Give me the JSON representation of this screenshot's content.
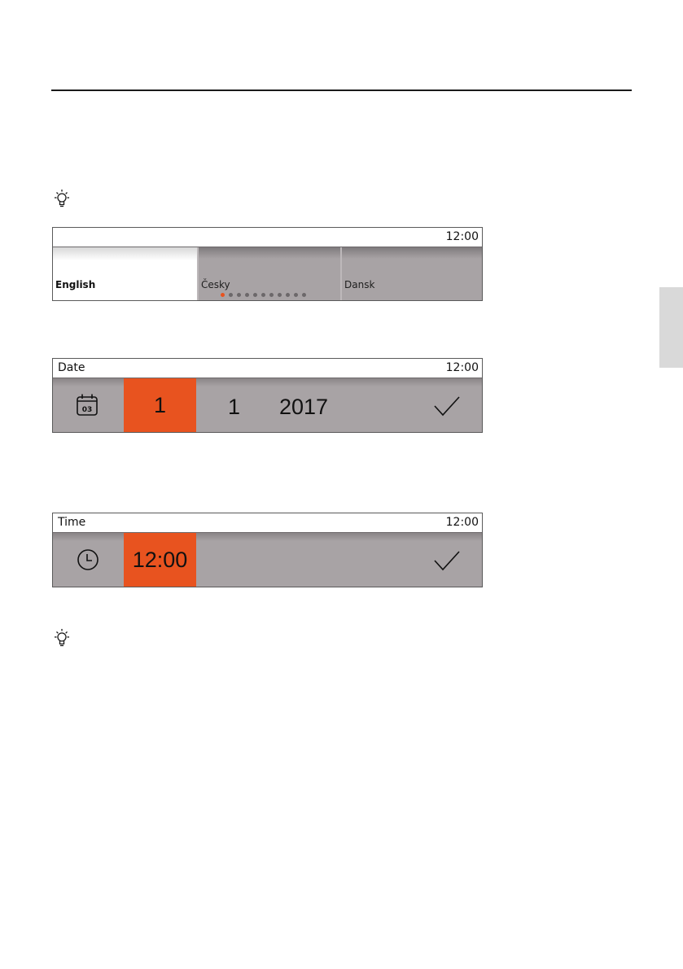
{
  "language_screen": {
    "clock": "12:00",
    "languages": [
      {
        "label": "English",
        "selected": true
      },
      {
        "label": "Česky",
        "selected": false
      },
      {
        "label": "Dansk",
        "selected": false
      }
    ],
    "page_indicator": {
      "count": 11,
      "active_index": 0
    }
  },
  "date_screen": {
    "title": "Date",
    "clock": "12:00",
    "icon": "calendar-icon",
    "icon_text": "03",
    "day": "1",
    "month": "1",
    "year": "2017",
    "confirm_icon": "check-icon"
  },
  "time_screen": {
    "title": "Time",
    "clock": "12:00",
    "icon": "clock-icon",
    "time": "12:00",
    "confirm_icon": "check-icon"
  },
  "colors": {
    "accent": "#e8531f",
    "panel": "#a8a3a5",
    "side_tab": "#d9d9d9"
  }
}
